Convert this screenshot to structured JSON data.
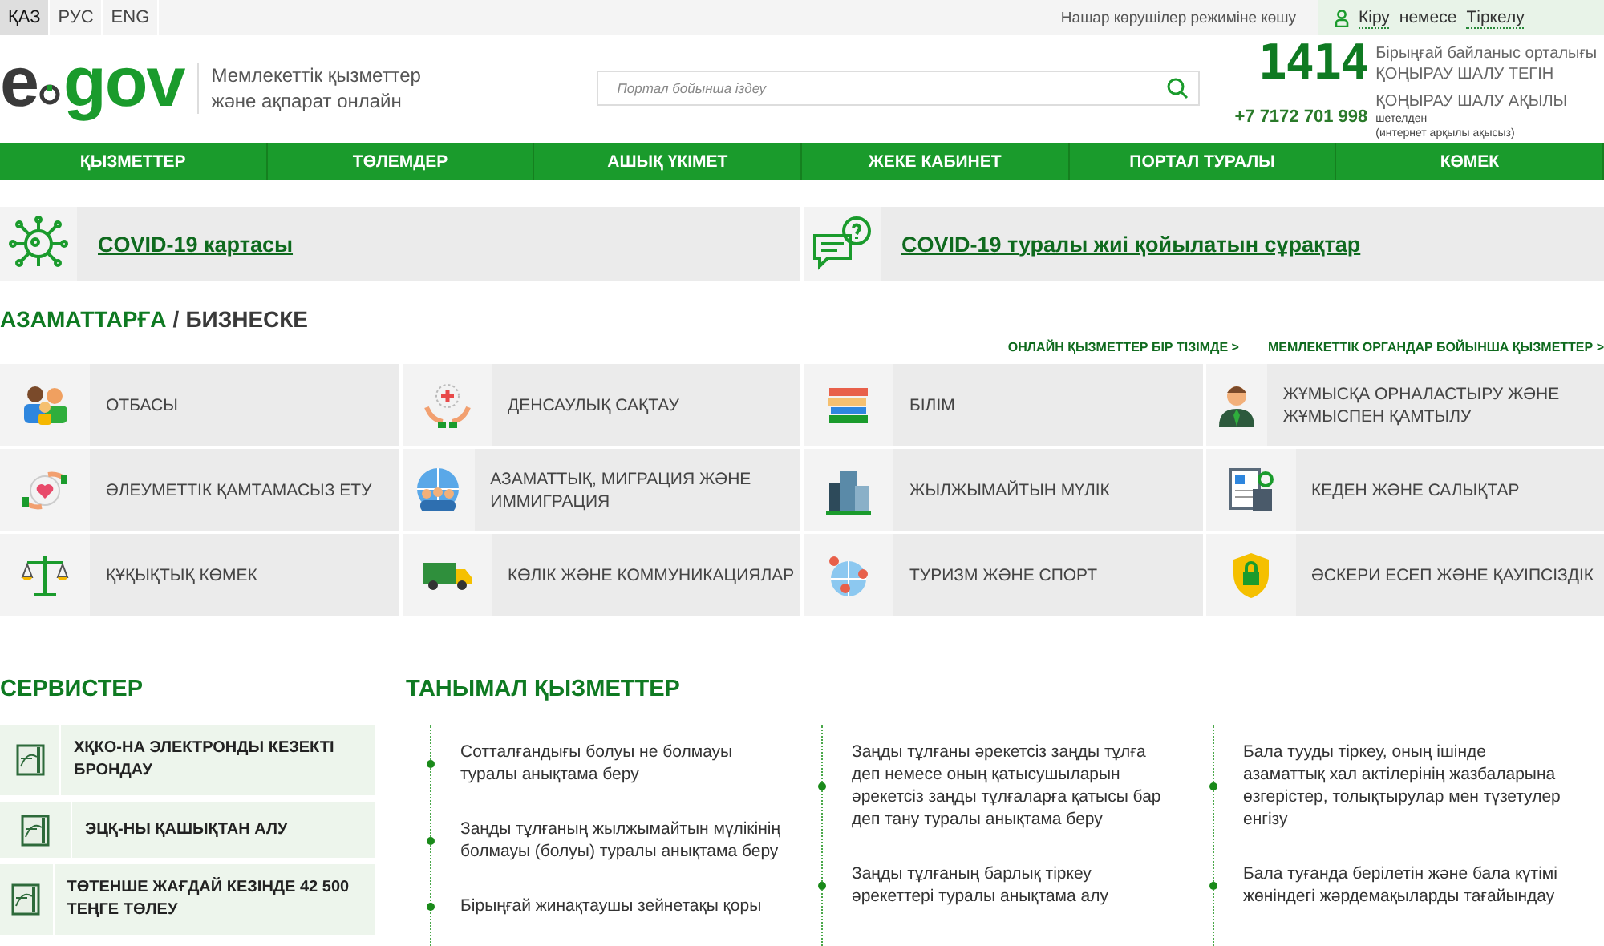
{
  "languages": [
    {
      "label": "ҚАЗ",
      "selected": true
    },
    {
      "label": "РУС",
      "selected": false
    },
    {
      "label": "ENG",
      "selected": false
    }
  ],
  "accessibility_link": "Нашар көрушілер режиміне көшу",
  "login": {
    "sign_in": "Кіру",
    "middle": "немесе",
    "register": "Тіркелу"
  },
  "logo": {
    "left": "e",
    "right": "gov"
  },
  "tagline": [
    "Мемлекеттік қызметтер",
    "және ақпарат онлайн"
  ],
  "search": {
    "placeholder": "Портал бойынша іздеу"
  },
  "contact": {
    "short_number": "1414",
    "short_title": "Бірыңғай байланыс орталығы",
    "short_note": "ҚОҢЫРАУ ШАЛУ ТЕГІН",
    "long_number": "+7 7172 701 998",
    "long_note": "ҚОҢЫРАУ ШАЛУ АҚЫЛЫ",
    "abroad": "шетелден",
    "abroad_note": "(интернет арқылы ақысыз)"
  },
  "nav": [
    "ҚЫЗМЕТТЕР",
    "ТӨЛЕМДЕР",
    "АШЫҚ ҮКІМЕТ",
    "ЖЕКЕ КАБИНЕТ",
    "ПОРТАЛ ТУРАЛЫ",
    "КӨМЕК"
  ],
  "covid_links": [
    {
      "kind": "map",
      "label": "COVID-19 картасы"
    },
    {
      "kind": "faq",
      "label": "COVID-19 туралы жиі қойылатын сұрақтар"
    }
  ],
  "audience_tabs": [
    {
      "label": "АЗАМАТТАРҒА",
      "selected": true
    },
    {
      "label": "БИЗНЕСКЕ",
      "selected": false
    }
  ],
  "audience_separator": "/",
  "quick_links": [
    "ОНЛАЙН ҚЫЗМЕТТЕР БІР ТІЗІМДЕ >",
    "МЕМЛЕКЕТТІК ОРГАНДАР БОЙЫНША ҚЫЗМЕТТЕР >"
  ],
  "categories": [
    {
      "kind": "family",
      "label": "ОТБАСЫ"
    },
    {
      "kind": "health",
      "label": "ДЕНСАУЛЫҚ САҚТАУ"
    },
    {
      "kind": "education",
      "label": "БІЛІМ"
    },
    {
      "kind": "employment",
      "label": "ЖҰМЫСҚА ОРНАЛАСТЫРУ ЖӘНЕ ЖҰМЫСПЕН ҚАМТЫЛУ"
    },
    {
      "kind": "social",
      "label": "ӘЛЕУМЕТТІК ҚАМТАМАСЫЗ ЕТУ"
    },
    {
      "kind": "citizenship",
      "label": "АЗАМАТТЫҚ, МИГРАЦИЯ ЖӘНЕ ИММИГРАЦИЯ"
    },
    {
      "kind": "realty",
      "label": "ЖЫЛЖЫМАЙТЫН МҮЛІК"
    },
    {
      "kind": "customs",
      "label": "КЕДЕН ЖӘНЕ САЛЫҚТАР"
    },
    {
      "kind": "legal",
      "label": "ҚҰҚЫҚТЫҚ КӨМЕК"
    },
    {
      "kind": "transport",
      "label": "КӨЛІК ЖӘНЕ КОММУНИКАЦИЯЛАР"
    },
    {
      "kind": "tourism",
      "label": "ТУРИЗМ ЖӘНЕ СПОРТ"
    },
    {
      "kind": "security",
      "label": "ӘСКЕРИ ЕСЕП ЖӘНЕ ҚАУІПСІЗДІК"
    }
  ],
  "services": {
    "title": "СЕРВИСТЕР",
    "items": [
      "ХҚКО-НА ЭЛЕКТРОНДЫ КЕЗЕКТІ БРОНДАУ",
      "ЭЦҚ-НЫ ҚАШЫҚТАН АЛУ",
      "ТӨТЕНШЕ ЖАҒДАЙ КЕЗІНДЕ 42 500 ТЕҢГЕ ТӨЛЕУ"
    ]
  },
  "popular": {
    "title": "ТАНЫМАЛ ҚЫЗМЕТТЕР",
    "columns": [
      [
        "Сотталғандығы болуы не болмауы туралы анықтама беру",
        "Заңды тұлғаның жылжымайтын мүлікінің болмауы (болуы) туралы анықтама беру",
        "Бірыңғай жинақтаушы зейнетақы қоры"
      ],
      [
        "Заңды тұлғаны әрекетсіз заңды тұлға деп немесе оның қатысушыларын әрекетсіз заңды тұлғаларға қатысы бар деп тану туралы анықтама беру",
        "Заңды тұлғаның барлық тіркеу әрекеттері туралы анықтама алу"
      ],
      [
        "Бала тууды тіркеу, оның ішінде азаматтық хал актілерінің жазбаларына өзгерістер, толықтырулар мен түзетулер енгізу",
        "Бала туғанда берілетін және бала күтімі жөніндегі жәрдемақыларды тағайындау"
      ]
    ]
  }
}
